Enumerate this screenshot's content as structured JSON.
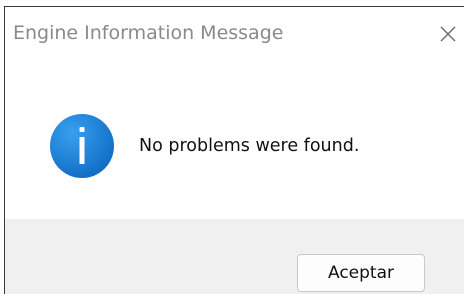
{
  "dialog": {
    "title": "Engine Information Message",
    "message": "No problems were found.",
    "ok_label": "Aceptar",
    "close_icon": "close-icon",
    "info_icon": "info-icon",
    "accent_color": "#1a7fd4"
  }
}
